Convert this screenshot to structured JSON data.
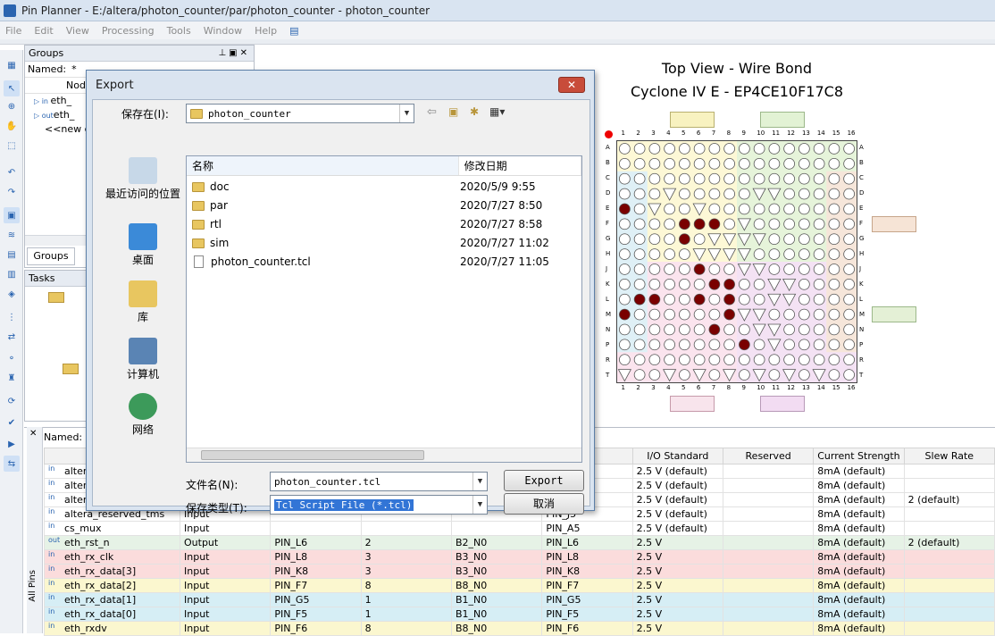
{
  "window": {
    "title": "Pin Planner - E:/altera/photon_counter/par/photon_counter - photon_counter"
  },
  "menu": [
    "File",
    "Edit",
    "View",
    "Processing",
    "Tools",
    "Window",
    "Help"
  ],
  "groups": {
    "title": "Groups",
    "named_label": "Named:",
    "named_value": "*",
    "col_node": "Node",
    "rows": [
      "eth_",
      "eth_",
      "<<new g"
    ],
    "tab": "Groups"
  },
  "tasks": {
    "title": "Tasks"
  },
  "chip": {
    "title": "Top View - Wire Bond",
    "subtitle": "Cyclone IV E - EP4CE10F17C8",
    "cols": [
      "1",
      "2",
      "3",
      "4",
      "5",
      "6",
      "7",
      "8",
      "9",
      "10",
      "11",
      "12",
      "13",
      "14",
      "15",
      "16"
    ],
    "rows": [
      "A",
      "B",
      "C",
      "D",
      "E",
      "F",
      "G",
      "H",
      "J",
      "K",
      "L",
      "M",
      "N",
      "P",
      "R",
      "T"
    ]
  },
  "dialog": {
    "title": "Export",
    "save_in_label": "保存在(I):",
    "save_in_value": "photon_counter",
    "places": [
      "最近访问的位置",
      "桌面",
      "库",
      "计算机",
      "网络"
    ],
    "col_name": "名称",
    "col_date": "修改日期",
    "files": [
      {
        "name": "doc",
        "date": "2020/5/9 9:55",
        "type": "folder"
      },
      {
        "name": "par",
        "date": "2020/7/27 8:50",
        "type": "folder"
      },
      {
        "name": "rtl",
        "date": "2020/7/27 8:58",
        "type": "folder"
      },
      {
        "name": "sim",
        "date": "2020/7/27 11:02",
        "type": "folder"
      },
      {
        "name": "photon_counter.tcl",
        "date": "2020/7/27 11:05",
        "type": "file"
      }
    ],
    "filename_label": "文件名(N):",
    "filename_value": "photon_counter.tcl",
    "filetype_label": "保存类型(T):",
    "filetype_value": "Tcl Script File (*.tcl)",
    "export_button": "Export",
    "cancel_button": "取消"
  },
  "pins": {
    "named_label": "Named:",
    "side_tab": "All Pins",
    "headers": [
      "",
      "",
      "",
      "",
      "",
      "tion",
      "I/O Standard",
      "Reserved",
      "Current Strength",
      "Slew Rate"
    ],
    "rows": [
      {
        "name": "alter",
        "dir": "",
        "loc": "",
        "bank": "",
        "vref": "",
        "fit": "",
        "std": "2.5 V (default)",
        "res": "",
        "cur": "8mA (default)",
        "slew": "",
        "color": "#ffffff"
      },
      {
        "name": "alter",
        "dir": "",
        "loc": "",
        "bank": "",
        "vref": "",
        "fit": "",
        "std": "2.5 V (default)",
        "res": "",
        "cur": "8mA (default)",
        "slew": "",
        "color": "#ffffff"
      },
      {
        "name": "alter",
        "dir": "",
        "loc": "",
        "bank": "",
        "vref": "",
        "fit": "",
        "std": "2.5 V (default)",
        "res": "",
        "cur": "8mA (default)",
        "slew": "2 (default)",
        "color": "#ffffff"
      },
      {
        "name": "altera_reserved_tms",
        "dir": "Input",
        "loc": "",
        "bank": "",
        "vref": "",
        "fit": "PIN_J5",
        "std": "2.5 V (default)",
        "res": "",
        "cur": "8mA (default)",
        "slew": "",
        "color": "#ffffff"
      },
      {
        "name": "cs_mux",
        "dir": "Input",
        "loc": "",
        "bank": "",
        "vref": "",
        "fit": "PIN_A5",
        "std": "2.5 V (default)",
        "res": "",
        "cur": "8mA (default)",
        "slew": "",
        "color": "#ffffff"
      },
      {
        "name": "eth_rst_n",
        "dir": "Output",
        "loc": "PIN_L6",
        "bank": "2",
        "vref": "B2_N0",
        "fit": "PIN_L6",
        "std": "2.5 V",
        "res": "",
        "cur": "8mA (default)",
        "slew": "2 (default)",
        "color": "#e6f2e6"
      },
      {
        "name": "eth_rx_clk",
        "dir": "Input",
        "loc": "PIN_L8",
        "bank": "3",
        "vref": "B3_N0",
        "fit": "PIN_L8",
        "std": "2.5 V",
        "res": "",
        "cur": "8mA (default)",
        "slew": "",
        "color": "#fbdcdc"
      },
      {
        "name": "eth_rx_data[3]",
        "dir": "Input",
        "loc": "PIN_K8",
        "bank": "3",
        "vref": "B3_N0",
        "fit": "PIN_K8",
        "std": "2.5 V",
        "res": "",
        "cur": "8mA (default)",
        "slew": "",
        "color": "#fbdcdc"
      },
      {
        "name": "eth_rx_data[2]",
        "dir": "Input",
        "loc": "PIN_F7",
        "bank": "8",
        "vref": "B8_N0",
        "fit": "PIN_F7",
        "std": "2.5 V",
        "res": "",
        "cur": "8mA (default)",
        "slew": "",
        "color": "#fbf7cf"
      },
      {
        "name": "eth_rx_data[1]",
        "dir": "Input",
        "loc": "PIN_G5",
        "bank": "1",
        "vref": "B1_N0",
        "fit": "PIN_G5",
        "std": "2.5 V",
        "res": "",
        "cur": "8mA (default)",
        "slew": "",
        "color": "#d6eef5"
      },
      {
        "name": "eth_rx_data[0]",
        "dir": "Input",
        "loc": "PIN_F5",
        "bank": "1",
        "vref": "B1_N0",
        "fit": "PIN_F5",
        "std": "2.5 V",
        "res": "",
        "cur": "8mA (default)",
        "slew": "",
        "color": "#d6eef5"
      },
      {
        "name": "eth_rxdv",
        "dir": "Input",
        "loc": "PIN_F6",
        "bank": "8",
        "vref": "B8_N0",
        "fit": "PIN_F6",
        "std": "2.5 V",
        "res": "",
        "cur": "8mA (default)",
        "slew": "",
        "color": "#fbf7cf"
      }
    ]
  }
}
